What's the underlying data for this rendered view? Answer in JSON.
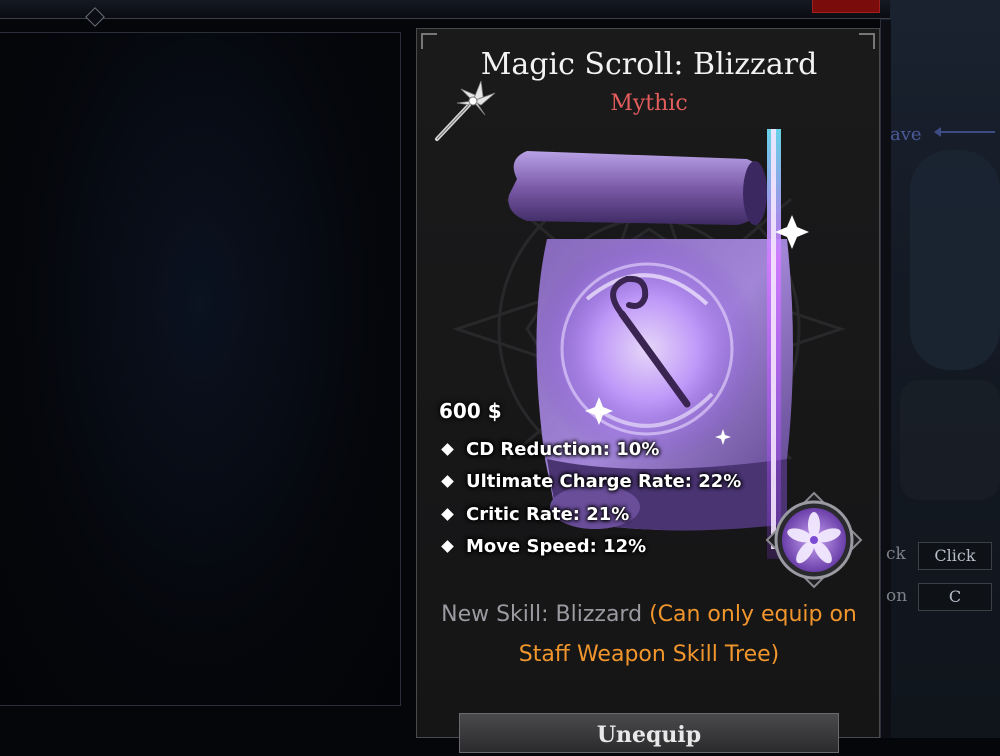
{
  "item": {
    "title": "Magic Scroll: Blizzard",
    "rarity": "Mythic",
    "rarity_color": "#e45d5d",
    "price": "600 $",
    "stats": [
      {
        "label": "CD Reduction: 10%"
      },
      {
        "label": "Ultimate Charge Rate: 22%"
      },
      {
        "label": "Critic Rate: 21%"
      },
      {
        "label": "Move Speed: 12%"
      }
    ],
    "skill_prefix": "New Skill: Blizzard",
    "skill_note": "(Can only equip on Staff Weapon Skill Tree)",
    "weapon_icon": "staff-icon",
    "skill_icon": "flower-skill-icon"
  },
  "actions": {
    "unequip_label": "Unequip"
  },
  "background_ui": {
    "save_hint": "ave",
    "rows": [
      {
        "label": "ck",
        "key": "Click"
      },
      {
        "label": "on",
        "key": "C"
      }
    ]
  },
  "colors": {
    "accent_orange": "#f0962c",
    "mythic_red": "#e45d5d",
    "scroll_purple": "#8b5cf6"
  }
}
